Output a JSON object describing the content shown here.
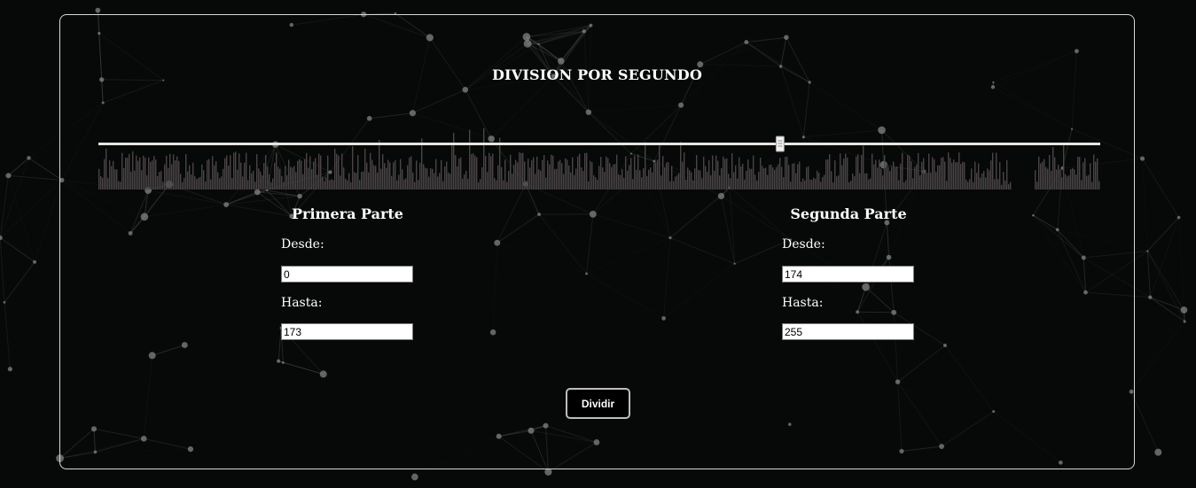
{
  "page": {
    "title": "DIVISION POR SEGUNDO"
  },
  "waveform": {
    "bar_color": "#4a4446",
    "track_color": "#e8e4e0",
    "handle_position": 0.68,
    "total_seconds": 255
  },
  "first_part": {
    "title": "Primera Parte",
    "from_label": "Desde:",
    "from_value": "0",
    "to_label": "Hasta:",
    "to_value": "173"
  },
  "second_part": {
    "title": "Segunda Parte",
    "from_label": "Desde:",
    "from_value": "174",
    "to_label": "Hasta:",
    "to_value": "255"
  },
  "actions": {
    "divide_label": "Dividir"
  },
  "colors": {
    "background": "#060907",
    "panel_border": "#d8d8d8",
    "text": "#ffffff"
  }
}
